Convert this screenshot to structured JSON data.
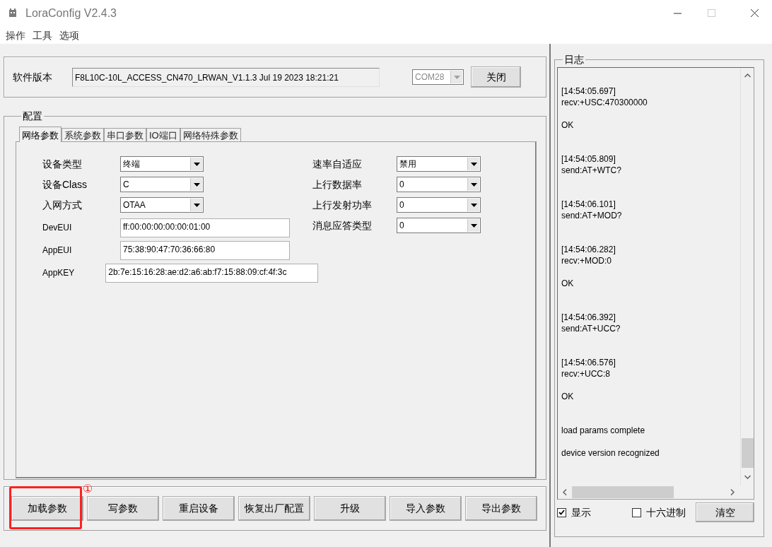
{
  "window": {
    "title": "LoraConfig V2.4.3"
  },
  "menu": [
    "操作",
    "工具",
    "选项"
  ],
  "version": {
    "label": "软件版本",
    "value": "F8L10C-10L_ACCESS_CN470_LRWAN_V1.1.3 Jul 19 2023 18:21:21",
    "port": {
      "value": "COM28",
      "disabled": true
    },
    "button": "关闭"
  },
  "config": {
    "title": "配置",
    "tabs": [
      {
        "label": "网络参数",
        "selected": true
      },
      {
        "label": "系统参数",
        "selected": false
      },
      {
        "label": "串口参数",
        "selected": false
      },
      {
        "label": "IO端口",
        "selected": false
      },
      {
        "label": "网络特殊参数",
        "selected": false
      }
    ],
    "left_fields": [
      {
        "label": "设备类型",
        "kind": "select",
        "value": "终端"
      },
      {
        "label": "设备Class",
        "kind": "select",
        "value": "C"
      },
      {
        "label": "入网方式",
        "kind": "select",
        "value": "OTAA"
      },
      {
        "label": "DevEUI",
        "kind": "text",
        "value": "ff:00:00:00:00:00:01:00"
      },
      {
        "label": "AppEUI",
        "kind": "text",
        "value": "75:38:90:47:70:36:66:80"
      },
      {
        "label": "AppKEY",
        "kind": "wide_text",
        "value": "2b:7e:15:16:28:ae:d2:a6:ab:f7:15:88:09:cf:4f:3c"
      }
    ],
    "right_fields": [
      {
        "label": "速率自适应",
        "kind": "select",
        "value": "禁用"
      },
      {
        "label": "上行数据率",
        "kind": "select",
        "value": "0"
      },
      {
        "label": "上行发射功率",
        "kind": "select",
        "value": "0"
      },
      {
        "label": "消息应答类型",
        "kind": "select",
        "value": "0"
      }
    ]
  },
  "actions": [
    {
      "label": "加载参数",
      "highlighted": true
    },
    {
      "label": "写参数",
      "highlighted": false
    },
    {
      "label": "重启设备",
      "highlighted": false
    },
    {
      "label": "恢复出厂配置",
      "highlighted": false
    },
    {
      "label": "升级",
      "highlighted": false
    },
    {
      "label": "导入参数",
      "highlighted": false
    },
    {
      "label": "导出参数",
      "highlighted": false
    }
  ],
  "annotation": "①",
  "log": {
    "title": "日志",
    "entries": [
      {
        "kind": "message",
        "lines": [
          "[14:54:05.697]",
          "recv:+USC:470300000"
        ]
      },
      {
        "kind": "reply",
        "lines": [
          "OK"
        ]
      },
      {
        "kind": "message",
        "lines": [
          "[14:54:05.809]",
          "send:AT+WTC?"
        ]
      },
      {
        "kind": "message",
        "lines": [
          "[14:54:06.101]",
          "send:AT+MOD?"
        ]
      },
      {
        "kind": "message",
        "lines": [
          "[14:54:06.282]",
          "recv:+MOD:0"
        ]
      },
      {
        "kind": "reply",
        "lines": [
          "OK"
        ]
      },
      {
        "kind": "message",
        "lines": [
          "[14:54:06.392]",
          "send:AT+UCC?"
        ]
      },
      {
        "kind": "message",
        "lines": [
          "[14:54:06.576]",
          "recv:+UCC:8"
        ]
      },
      {
        "kind": "reply",
        "lines": [
          "OK"
        ]
      },
      {
        "kind": "message",
        "lines": [
          "load params complete"
        ]
      },
      {
        "kind": "reply",
        "lines": [
          "device version recognized"
        ]
      }
    ],
    "show": {
      "label": "显示",
      "checked": true
    },
    "hex": {
      "label": "十六进制",
      "checked": false
    },
    "clear": "清空"
  }
}
